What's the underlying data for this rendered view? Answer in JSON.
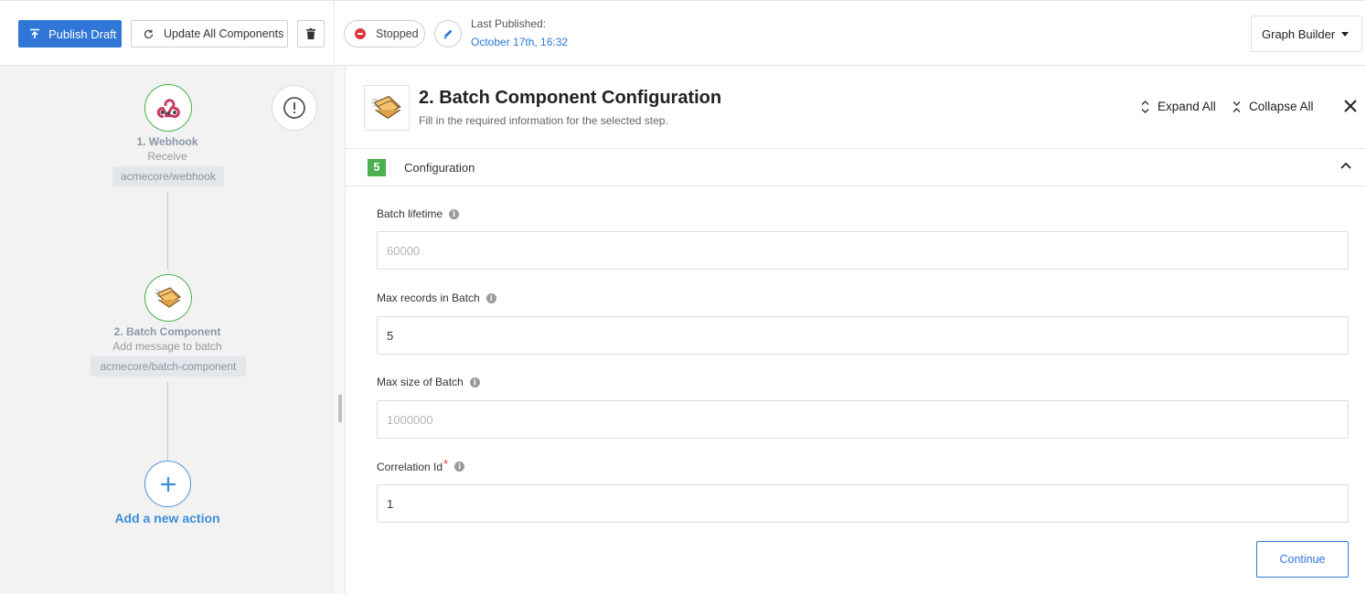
{
  "toolbar": {
    "publish_label": "Publish Draft",
    "update_label": "Update All Components",
    "status_label": "Stopped",
    "last_published_label": "Last Published:",
    "last_published_date": "October 17th, 16:32",
    "view_selector": "Graph Builder"
  },
  "flow": {
    "nodes": [
      {
        "title": "1. Webhook",
        "subtitle": "Receive",
        "tag": "acmecore/webhook",
        "icon": "webhook-icon"
      },
      {
        "title": "2. Batch Component",
        "subtitle": "Add message to batch",
        "tag": "acmecore/batch-component",
        "icon": "batch-component-icon"
      }
    ],
    "add_action_label": "Add a new action"
  },
  "panel": {
    "title": "2. Batch Component Configuration",
    "subtitle": "Fill in the required information for the selected step.",
    "expand_all": "Expand All",
    "collapse_all": "Collapse All",
    "section": {
      "step_number": "5",
      "title": "Configuration"
    },
    "fields": [
      {
        "label": "Batch lifetime",
        "value": "",
        "placeholder": "60000",
        "required": false
      },
      {
        "label": "Max records in Batch",
        "value": "5",
        "placeholder": "",
        "required": false
      },
      {
        "label": "Max size of Batch",
        "value": "",
        "placeholder": "1000000",
        "required": false
      },
      {
        "label": "Correlation Id",
        "value": "1",
        "placeholder": "",
        "required": true,
        "required_mark": "*"
      }
    ],
    "continue_label": "Continue"
  },
  "colors": {
    "primary": "#2f76d6",
    "success": "#4caf50",
    "danger": "#d9373c",
    "canvas_bg": "#f2f2f2"
  }
}
